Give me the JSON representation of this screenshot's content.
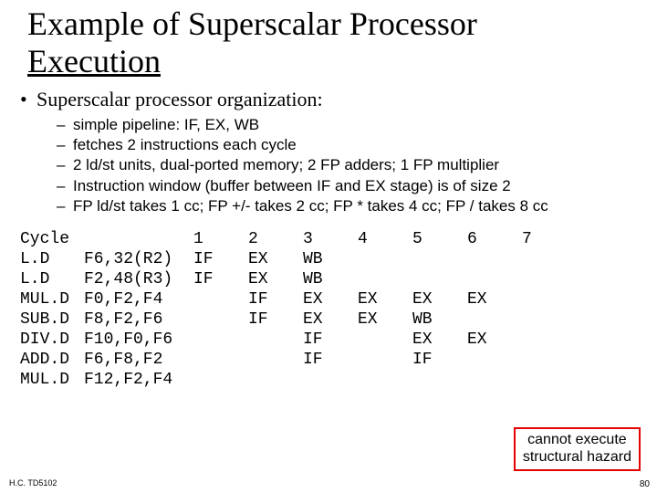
{
  "title_line1": "Example of Superscalar Processor",
  "title_line2": "Execution",
  "heading": "Superscalar processor organization:",
  "bullets": [
    "simple pipeline: IF, EX, WB",
    "fetches 2 instructions each cycle",
    "2 ld/st units, dual-ported memory; 2 FP adders; 1 FP multiplier",
    "Instruction window (buffer between IF and EX stage) is of size 2",
    "FP ld/st takes 1 cc; FP +/- takes 2 cc; FP * takes 4 cc; FP / takes 8 cc"
  ],
  "table": {
    "header": [
      "Cycle",
      "",
      "1",
      "2",
      "3",
      "4",
      "5",
      "6",
      "7"
    ],
    "rows": [
      [
        "L.D",
        "F6,32(R2)",
        "IF",
        "EX",
        "WB",
        "",
        "",
        "",
        ""
      ],
      [
        "L.D",
        "F2,48(R3)",
        "IF",
        "EX",
        "WB",
        "",
        "",
        "",
        ""
      ],
      [
        "MUL.D",
        "F0,F2,F4",
        "",
        "IF",
        "EX",
        "EX",
        "EX",
        "EX",
        ""
      ],
      [
        "SUB.D",
        "F8,F2,F6",
        "",
        "IF",
        "EX",
        "EX",
        "WB",
        "",
        ""
      ],
      [
        "DIV.D",
        "F10,F0,F6",
        "",
        "",
        "IF",
        "",
        "EX",
        "EX",
        ""
      ],
      [
        "ADD.D",
        "F6,F8,F2",
        "",
        "",
        "IF",
        "",
        "IF",
        "",
        ""
      ],
      [
        "MUL.D",
        "F12,F2,F4",
        "",
        "",
        "",
        "",
        "",
        "",
        ""
      ]
    ]
  },
  "hazard_line1": "cannot execute",
  "hazard_line2": "structural hazard",
  "footer_left": "H.C. TD5102",
  "footer_right": "80"
}
